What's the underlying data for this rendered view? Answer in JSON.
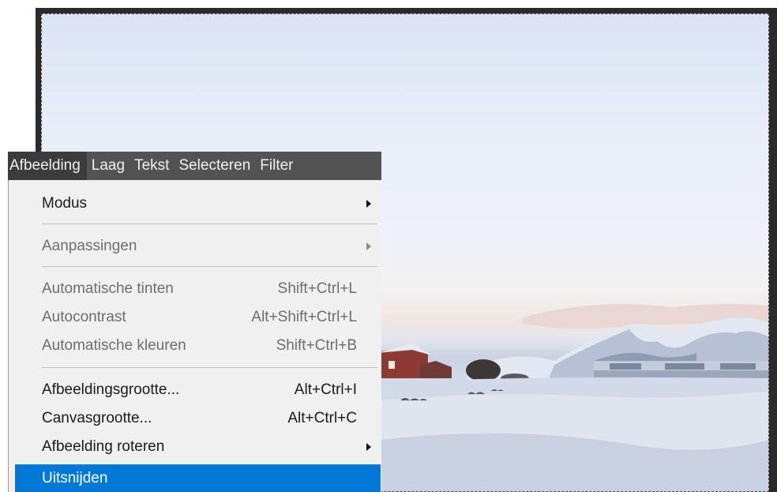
{
  "menubar": {
    "items": [
      "Afbeelding",
      "Laag",
      "Tekst",
      "Selecteren",
      "Filter"
    ]
  },
  "menu": {
    "modus": "Modus",
    "aanpassingen": "Aanpassingen",
    "auto_tinten": {
      "label": "Automatische tinten",
      "shortcut": "Shift+Ctrl+L"
    },
    "autocontrast": {
      "label": "Autocontrast",
      "shortcut": "Alt+Shift+Ctrl+L"
    },
    "auto_kleuren": {
      "label": "Automatische kleuren",
      "shortcut": "Shift+Ctrl+B"
    },
    "afbeeldingsgrootte": {
      "label": "Afbeeldingsgrootte...",
      "shortcut": "Alt+Ctrl+I"
    },
    "canvasgrootte": {
      "label": "Canvasgrootte...",
      "shortcut": "Alt+Ctrl+C"
    },
    "roteren": "Afbeelding roteren",
    "uitsnijden": "Uitsnijden"
  },
  "colors": {
    "highlight": "#0078d7",
    "menubar": "#535353",
    "menu_bg": "#f0f0f0"
  }
}
